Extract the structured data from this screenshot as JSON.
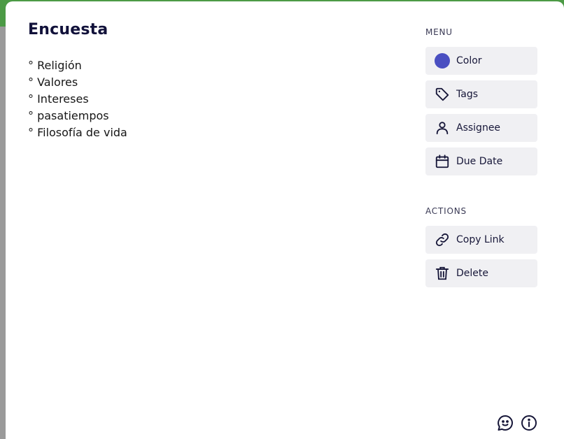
{
  "card": {
    "title": "Encuesta",
    "items": [
      "° Religión",
      "° Valores",
      "° Intereses",
      "° pasatiempos",
      "° Filosofía de vida"
    ]
  },
  "menu": {
    "label": "MENU",
    "color_label": "Color",
    "tags_label": "Tags",
    "assignee_label": "Assignee",
    "due_date_label": "Due Date",
    "current_color": "#4a4fc1"
  },
  "actions": {
    "label": "ACTIONS",
    "copy_link_label": "Copy Link",
    "delete_label": "Delete"
  },
  "icons": {
    "color": "color-swatch-icon",
    "tags": "tag-icon",
    "assignee": "person-icon",
    "due_date": "calendar-icon",
    "copy_link": "link-icon",
    "delete": "trash-icon",
    "feedback": "chat-smile-icon",
    "info": "info-icon"
  }
}
